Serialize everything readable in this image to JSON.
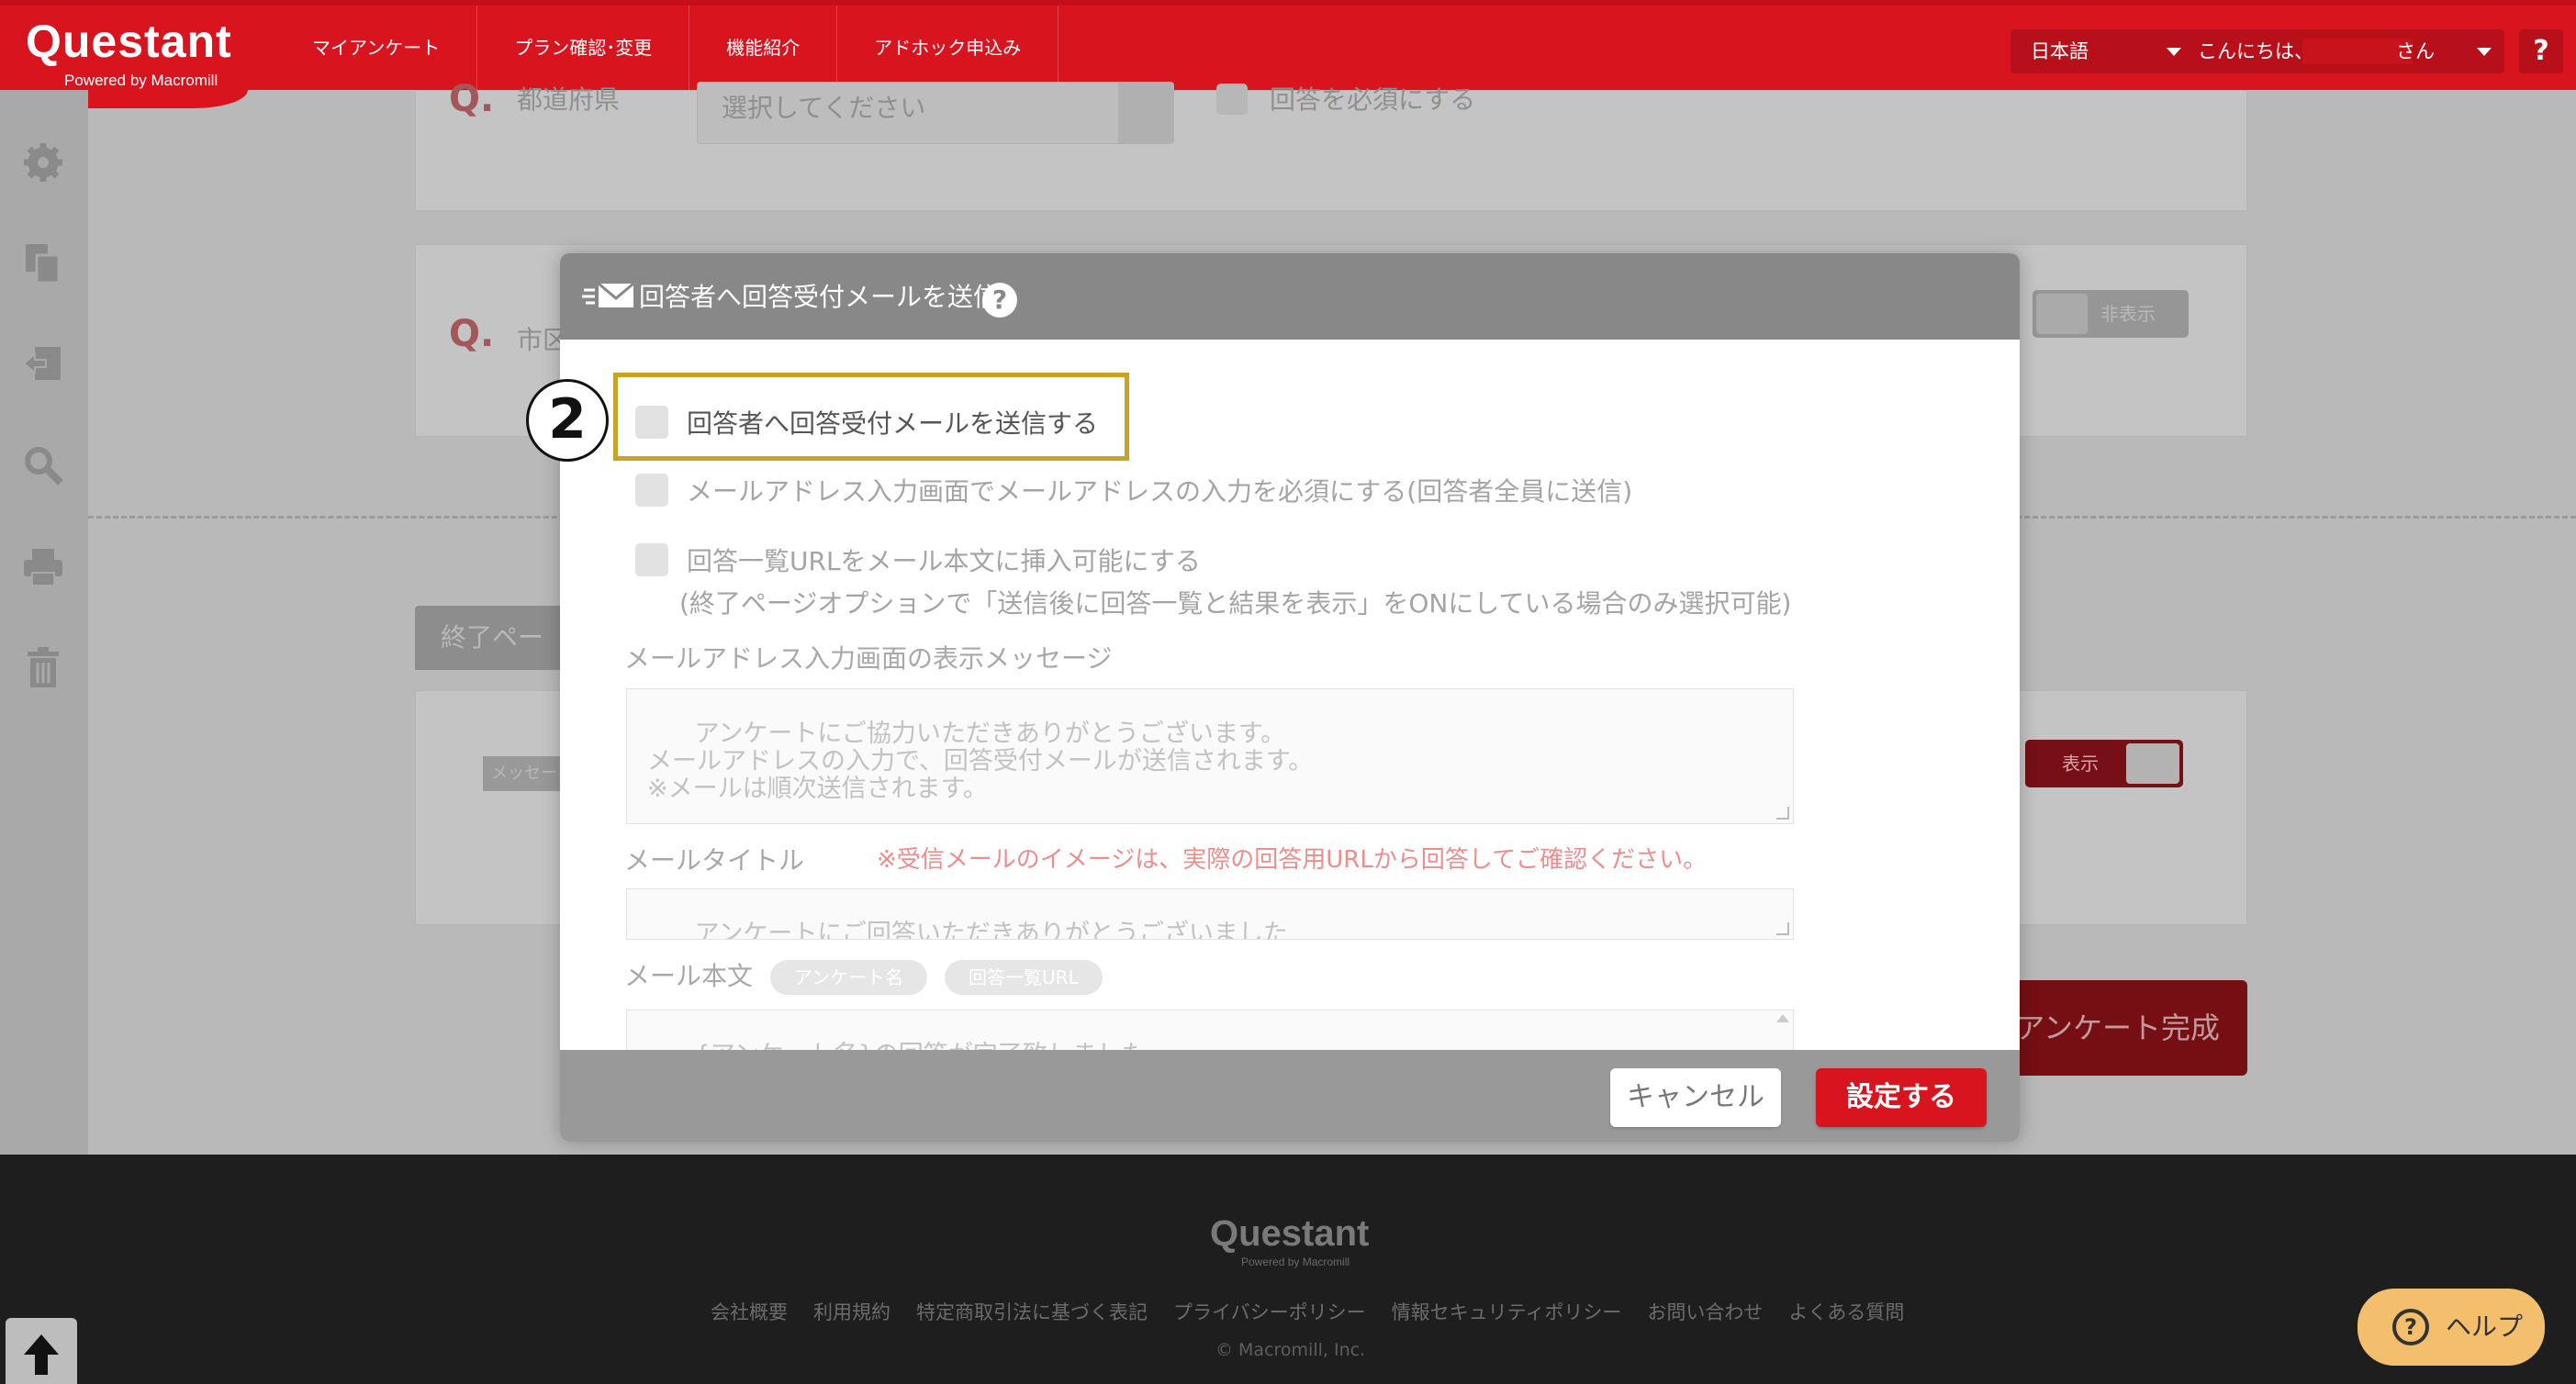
{
  "brand": {
    "logo": "Questant",
    "sub": "Powered by Macromill"
  },
  "nav": [
    {
      "label": "マイアンケート"
    },
    {
      "label": "プラン確認･変更"
    },
    {
      "label": "機能紹介"
    },
    {
      "label": "アドホック申込み"
    }
  ],
  "language": {
    "selected": "日本語"
  },
  "user": {
    "greeting": "こんにちは、",
    "suffix": "さん"
  },
  "help_icon_text": "?",
  "background": {
    "q_mark": "Q.",
    "q1_label": "都道府県",
    "q1_select_placeholder": "選択してください",
    "q1_required": "回答を必須にする",
    "q2_label": "市区",
    "hide_toggle": "非表示",
    "show_toggle": "表示",
    "end_page_tab": "終了ペー",
    "message_tag": "メッセー",
    "complete_button": "アンケート完成"
  },
  "modal": {
    "title": "回答者へ回答受付メールを送信",
    "help": "?",
    "step_badge": "2",
    "options": [
      {
        "label": "回答者へ回答受付メールを送信する",
        "checked": false
      },
      {
        "label": "メールアドレス入力画面でメールアドレスの入力を必須にする(回答者全員に送信)",
        "checked": false
      },
      {
        "label": "回答一覧URLをメール本文に挿入可能にする",
        "checked": false
      }
    ],
    "option3_note": "(終了ページオプションで「送信後に回答一覧と結果を表示」をONにしている場合のみ選択可能)",
    "display_message": {
      "label": "メールアドレス入力画面の表示メッセージ",
      "value": "アンケートにご協力いただきありがとうございます。\nメールアドレスの入力で、回答受付メールが送信されます。\n※メールは順次送信されます。"
    },
    "mail_title": {
      "label": "メールタイトル",
      "note": "※受信メールのイメージは、実際の回答用URLから回答してご確認ください。",
      "value": "アンケートにご回答いただきありがとうございました"
    },
    "mail_body": {
      "label": "メール本文",
      "tags": [
        "アンケート名",
        "回答一覧URL"
      ],
      "value": "{アンケート名}の回答が完了致しました。\nご回答いただきありがとうございました。"
    },
    "cancel": "キャンセル",
    "submit": "設定する"
  },
  "footer": {
    "logo": "Questant",
    "logo_sub": "Powered by Macromill",
    "links": [
      "会社概要",
      "利用規約",
      "特定商取引法に基づく表記",
      "プライバシーポリシー",
      "情報セキュリティポリシー",
      "お問い合わせ",
      "よくある質問"
    ],
    "copyright": "© Macromill, Inc."
  },
  "help_button": {
    "label": "ヘルプ",
    "icon": "?"
  },
  "colors": {
    "brand_red": "#d8151f",
    "highlight": "#c8a422",
    "help_orange": "#f3bf6c",
    "note_red": "#f08c8c"
  }
}
